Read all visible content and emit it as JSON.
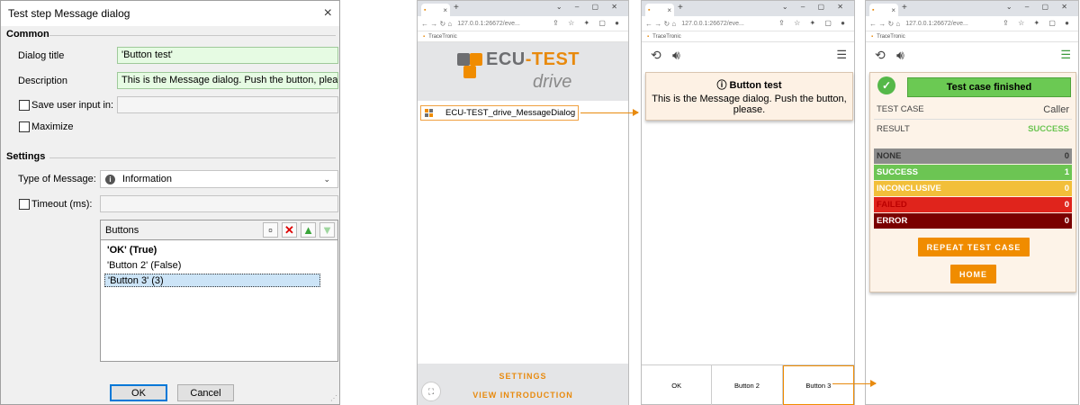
{
  "dialog": {
    "title": "Test step Message dialog",
    "close_icon": "×",
    "section_common": "Common",
    "dialog_title_label": "Dialog title",
    "dialog_title_value": "'Button test'",
    "description_label": "Description",
    "description_value": "This is the Message dialog. Push the button, please.'",
    "save_input_label": "Save user input in:",
    "maximize_label": "Maximize",
    "section_settings": "Settings",
    "type_label": "Type of Message:",
    "type_value": "Information",
    "timeout_label": "Timeout (ms):",
    "buttons_header": "Buttons",
    "buttons": [
      "'OK' (True)",
      "'Button 2' (False)",
      "'Button 3' (3)"
    ],
    "ok_label": "OK",
    "cancel_label": "Cancel"
  },
  "browser": {
    "tab_label": "...",
    "tab_close": "×",
    "new_tab": "+",
    "url": "127.0.0.1:26672/eve...",
    "bookmark": "TraceTronic"
  },
  "launcher": {
    "logo_text_ecu": "ECU",
    "logo_text_test": "-TEST",
    "logo_drive": "drive",
    "testcase": "ECU-TEST_drive_MessageDialog",
    "settings": "SETTINGS",
    "view_intro": "VIEW INTRODUCTION",
    "colors": {
      "orange": "#f08c00",
      "gray": "#6d6e71"
    }
  },
  "message": {
    "icon": "ⓘ",
    "title": "Button test",
    "text": "This is the Message dialog. Push the button, please.",
    "buttons": [
      "OK",
      "Button 2",
      "Button 3"
    ]
  },
  "result": {
    "finished": "Test case finished",
    "test_case_label": "TEST CASE",
    "test_case_value": "Caller",
    "result_label": "RESULT",
    "result_value": "SUCCESS",
    "stats": [
      {
        "label": "NONE",
        "value": "0",
        "color": "#8c8c8c"
      },
      {
        "label": "SUCCESS",
        "value": "1",
        "color": "#6cc553"
      },
      {
        "label": "INCONCLUSIVE",
        "value": "0",
        "color": "#f2bf3a"
      },
      {
        "label": "FAILED",
        "value": "0",
        "color": "#e0241c"
      },
      {
        "label": "ERROR",
        "value": "0",
        "color": "#7a0000"
      }
    ],
    "repeat": "REPEAT TEST CASE",
    "home": "HOME"
  }
}
